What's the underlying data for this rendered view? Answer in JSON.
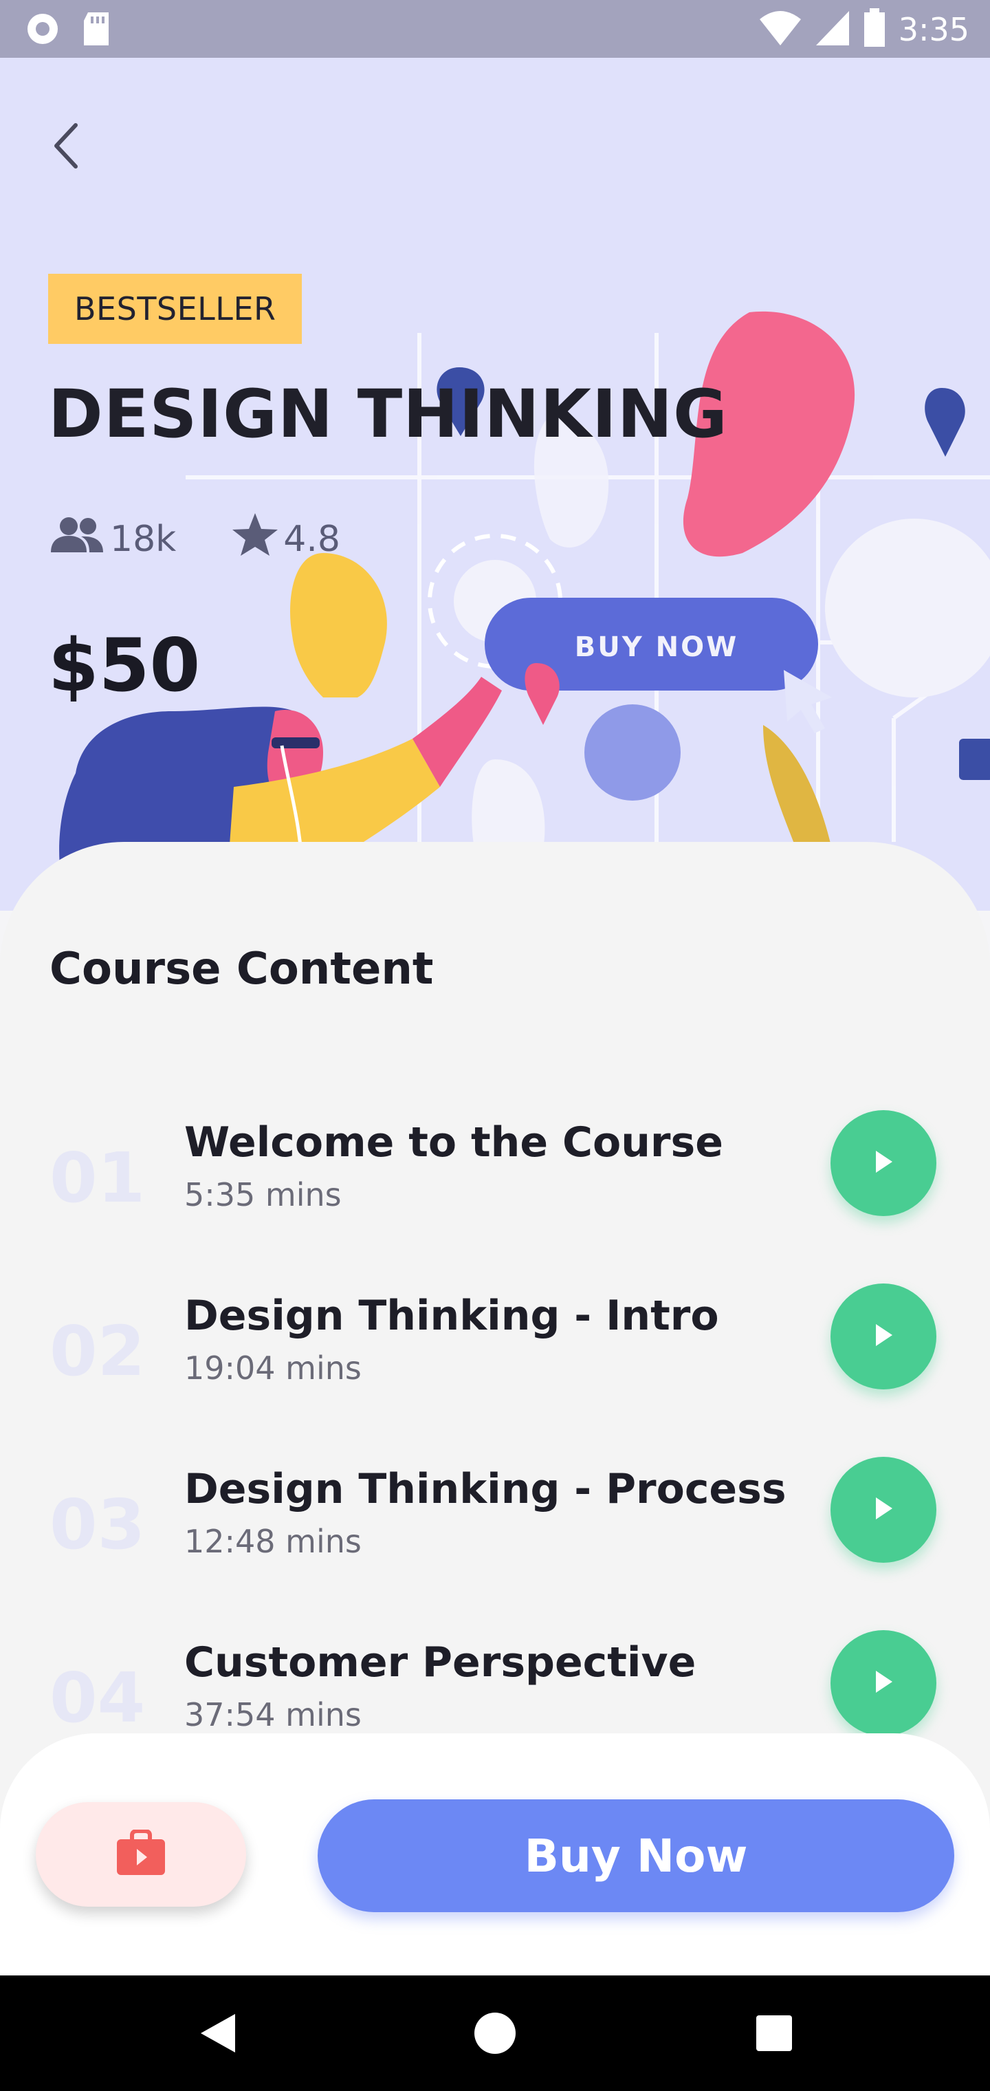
{
  "status_bar": {
    "time": "3:35",
    "icons": [
      "record-icon",
      "sd-card-icon",
      "wifi-icon",
      "signal-icon",
      "battery-icon"
    ]
  },
  "hero": {
    "back_icon": "chevron-left-icon",
    "badge": "BESTSELLER",
    "title": "DESIGN THINKING",
    "students": "18k",
    "rating": "4.8",
    "price": "$50",
    "illustration_button_text": "BUY NOW"
  },
  "course_content": {
    "heading": "Course Content",
    "lessons": [
      {
        "number": "01",
        "title": "Welcome to the Course",
        "duration": "5:35 mins"
      },
      {
        "number": "02",
        "title": "Design Thinking - Intro",
        "duration": "19:04 mins"
      },
      {
        "number": "03",
        "title": "Design Thinking - Process",
        "duration": "12:48 mins"
      },
      {
        "number": "04",
        "title": "Customer Perspective",
        "duration": "37:54 mins"
      }
    ]
  },
  "bottom_bar": {
    "cart_icon": "shopping-bag-icon",
    "buy_label": "Buy Now"
  },
  "nav_bar": {
    "icons": [
      "back-triangle-icon",
      "home-circle-icon",
      "recents-square-icon"
    ]
  },
  "colors": {
    "hero_bg": "#e0e1fb",
    "badge": "#ffcb64",
    "play": "#49cd92",
    "buy": "#6c88f4",
    "cart_bg": "#ffe9e9",
    "cart_icon": "#f25f5c"
  }
}
